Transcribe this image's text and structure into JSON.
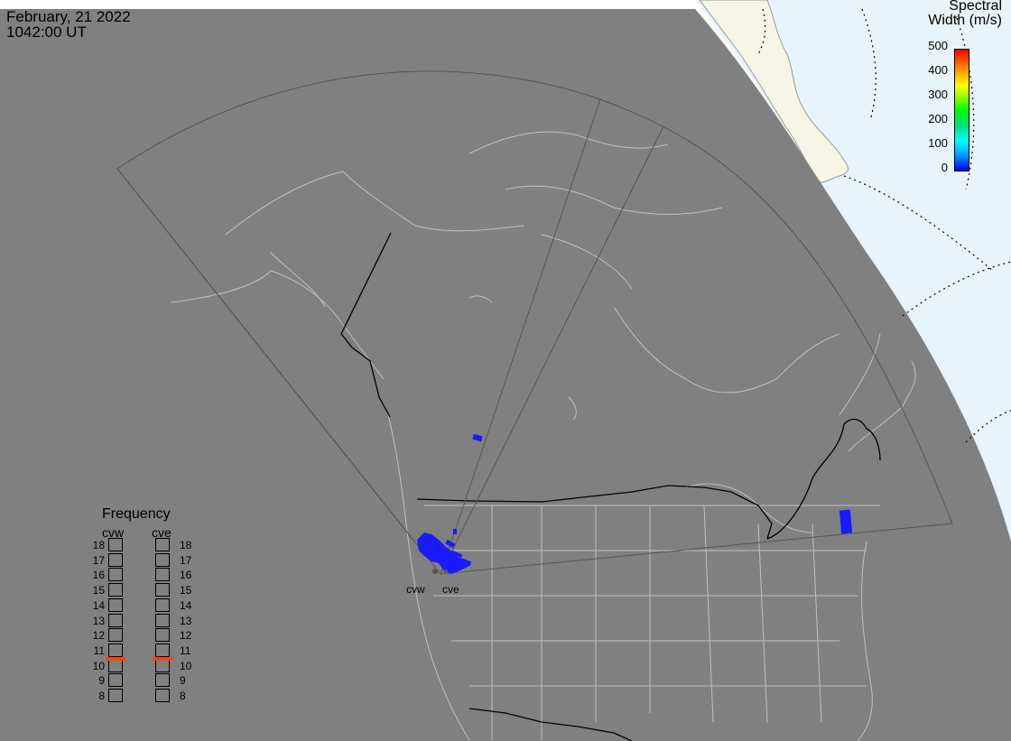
{
  "header": {
    "date": "February, 21 2022",
    "time": "1042:00 UT"
  },
  "legend": {
    "title_line1": "Spectral",
    "title_line2": "Width (m/s)",
    "ticks": [
      "500",
      "400",
      "300",
      "200",
      "100",
      "0"
    ],
    "range": [
      0,
      500
    ],
    "colors": {
      "low": "#0000ff",
      "mid": "#00ff00",
      "high": "#ff0000"
    }
  },
  "frequency_panel": {
    "title": "Frequency",
    "radars": [
      {
        "name": "cvw",
        "selected_mhz": 10.5
      },
      {
        "name": "cve",
        "selected_mhz": 10.5
      }
    ],
    "scale": [
      "18",
      "17",
      "16",
      "15",
      "14",
      "13",
      "12",
      "11",
      "10",
      "9",
      "8"
    ]
  },
  "sites": [
    {
      "label": "cvw"
    },
    {
      "label": "cve"
    }
  ],
  "colors": {
    "background_map": "#808080",
    "daylight": "#e8f4fb",
    "land_day": "#f7f5e6",
    "coast": "#bfbfbf",
    "border": "#000000",
    "fov": "#555555",
    "echo": "#1a1aff",
    "freq_marker": "#ff4500"
  }
}
